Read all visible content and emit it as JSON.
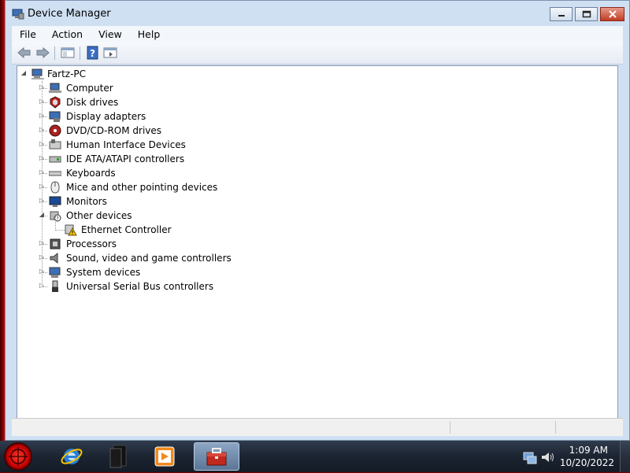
{
  "window": {
    "title": "Device Manager"
  },
  "menu": {
    "items": [
      "File",
      "Action",
      "View",
      "Help"
    ]
  },
  "toolbar": {
    "buttons": [
      "back-icon",
      "forward-icon",
      "console-tree-icon",
      "help-icon",
      "properties-icon"
    ]
  },
  "tree": {
    "root": "Fartz-PC",
    "categories": [
      {
        "label": "Computer",
        "expanded": false
      },
      {
        "label": "Disk drives",
        "expanded": false
      },
      {
        "label": "Display adapters",
        "expanded": false
      },
      {
        "label": "DVD/CD-ROM drives",
        "expanded": false
      },
      {
        "label": "Human Interface Devices",
        "expanded": false
      },
      {
        "label": "IDE ATA/ATAPI controllers",
        "expanded": false
      },
      {
        "label": "Keyboards",
        "expanded": false
      },
      {
        "label": "Mice and other pointing devices",
        "expanded": false
      },
      {
        "label": "Monitors",
        "expanded": false
      },
      {
        "label": "Other devices",
        "expanded": true,
        "children": [
          "Ethernet Controller"
        ]
      },
      {
        "label": "Processors",
        "expanded": false
      },
      {
        "label": "Sound, video and game controllers",
        "expanded": false
      },
      {
        "label": "System devices",
        "expanded": false
      },
      {
        "label": "Universal Serial Bus controllers",
        "expanded": false
      }
    ]
  },
  "taskbar": {
    "apps": [
      "internet-explorer-icon",
      "media-center-icon",
      "media-player-icon",
      "device-manager-toolbox-icon"
    ],
    "clock": {
      "time": "1:09 AM",
      "date": "10/20/2022"
    }
  },
  "colors": {
    "accent": "#c20000",
    "window_frame": "#cfe0f3",
    "warning": "#f5c400"
  }
}
